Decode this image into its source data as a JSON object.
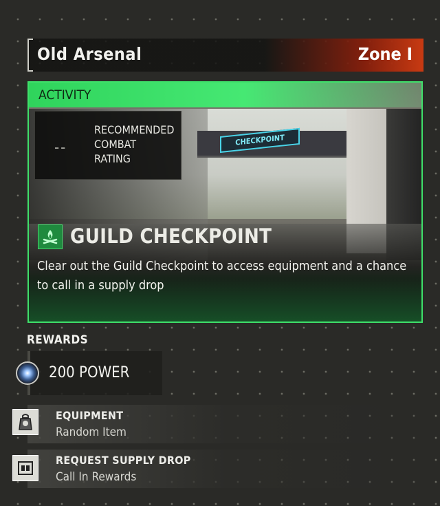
{
  "header": {
    "title": "Old Arsenal",
    "zone": "Zone I"
  },
  "activity": {
    "category_label": "ACTIVITY",
    "combat_rating_value": "--",
    "combat_rating_label": "RECOMMENDED\nCOMBAT\nRATING",
    "sign_text": "CHECKPOINT",
    "name": "GUILD CHECKPOINT",
    "description": "Clear out the Guild Checkpoint to access equipment and a chance to call in a supply drop",
    "icon": "campfire-icon",
    "accent_color": "#3fe06a"
  },
  "rewards": {
    "title": "REWARDS",
    "power": {
      "icon": "power-orb-icon",
      "label": "200 POWER"
    },
    "items": [
      {
        "icon": "equipment-bag-icon",
        "name": "EQUIPMENT",
        "sub": "Random Item"
      },
      {
        "icon": "supply-crate-icon",
        "name": "REQUEST SUPPLY DROP",
        "sub": "Call In Rewards"
      }
    ]
  },
  "colors": {
    "zone_gradient_end": "#c83a12",
    "activity_green": "#3fe06a"
  }
}
